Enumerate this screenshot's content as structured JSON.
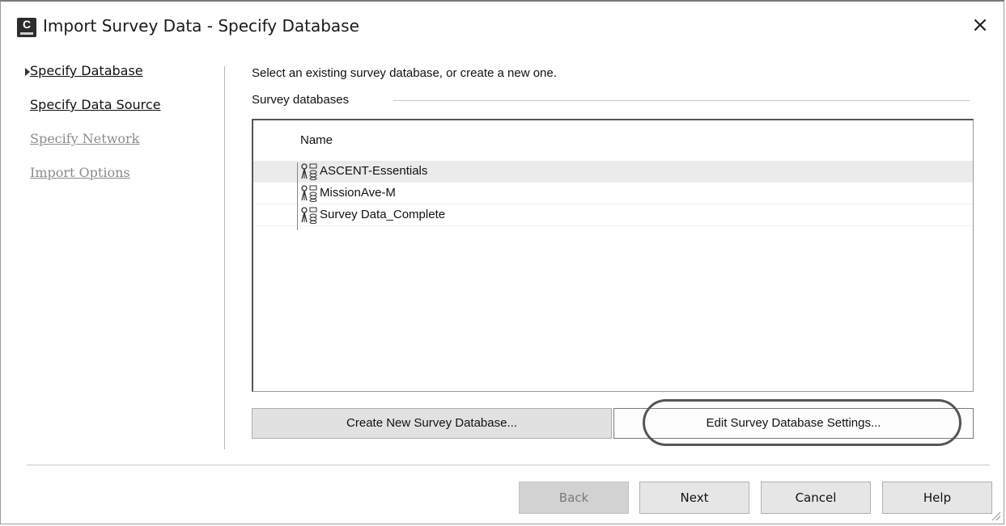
{
  "window": {
    "app_icon_letter": "C",
    "title": "Import Survey Data - Specify Database",
    "close_glyph": "×"
  },
  "nav": {
    "items": [
      {
        "label": "Specify Database",
        "state": "active"
      },
      {
        "label": "Specify Data Source",
        "state": "enabled"
      },
      {
        "label": "Specify Network",
        "state": "disabled"
      },
      {
        "label": "Import Options",
        "state": "disabled"
      }
    ]
  },
  "main": {
    "instruction": "Select an existing survey database, or create a new one.",
    "group_label": "Survey databases",
    "list": {
      "column_header": "Name",
      "rows": [
        {
          "label": "ASCENT-Essentials",
          "icon": "survey-database-icon",
          "selected": true
        },
        {
          "label": "MissionAve-M",
          "icon": "survey-database-icon",
          "selected": false
        },
        {
          "label": "Survey Data_Complete",
          "icon": "survey-database-icon",
          "selected": false
        }
      ]
    },
    "create_button": "Create New Survey Database...",
    "edit_button": "Edit Survey Database Settings..."
  },
  "footer": {
    "back": "Back",
    "next": "Next",
    "cancel": "Cancel",
    "help": "Help"
  },
  "colors": {
    "selected_row": "#ebebeb",
    "disabled_text": "#8c8c8c",
    "highlight_oval": "#555555"
  }
}
